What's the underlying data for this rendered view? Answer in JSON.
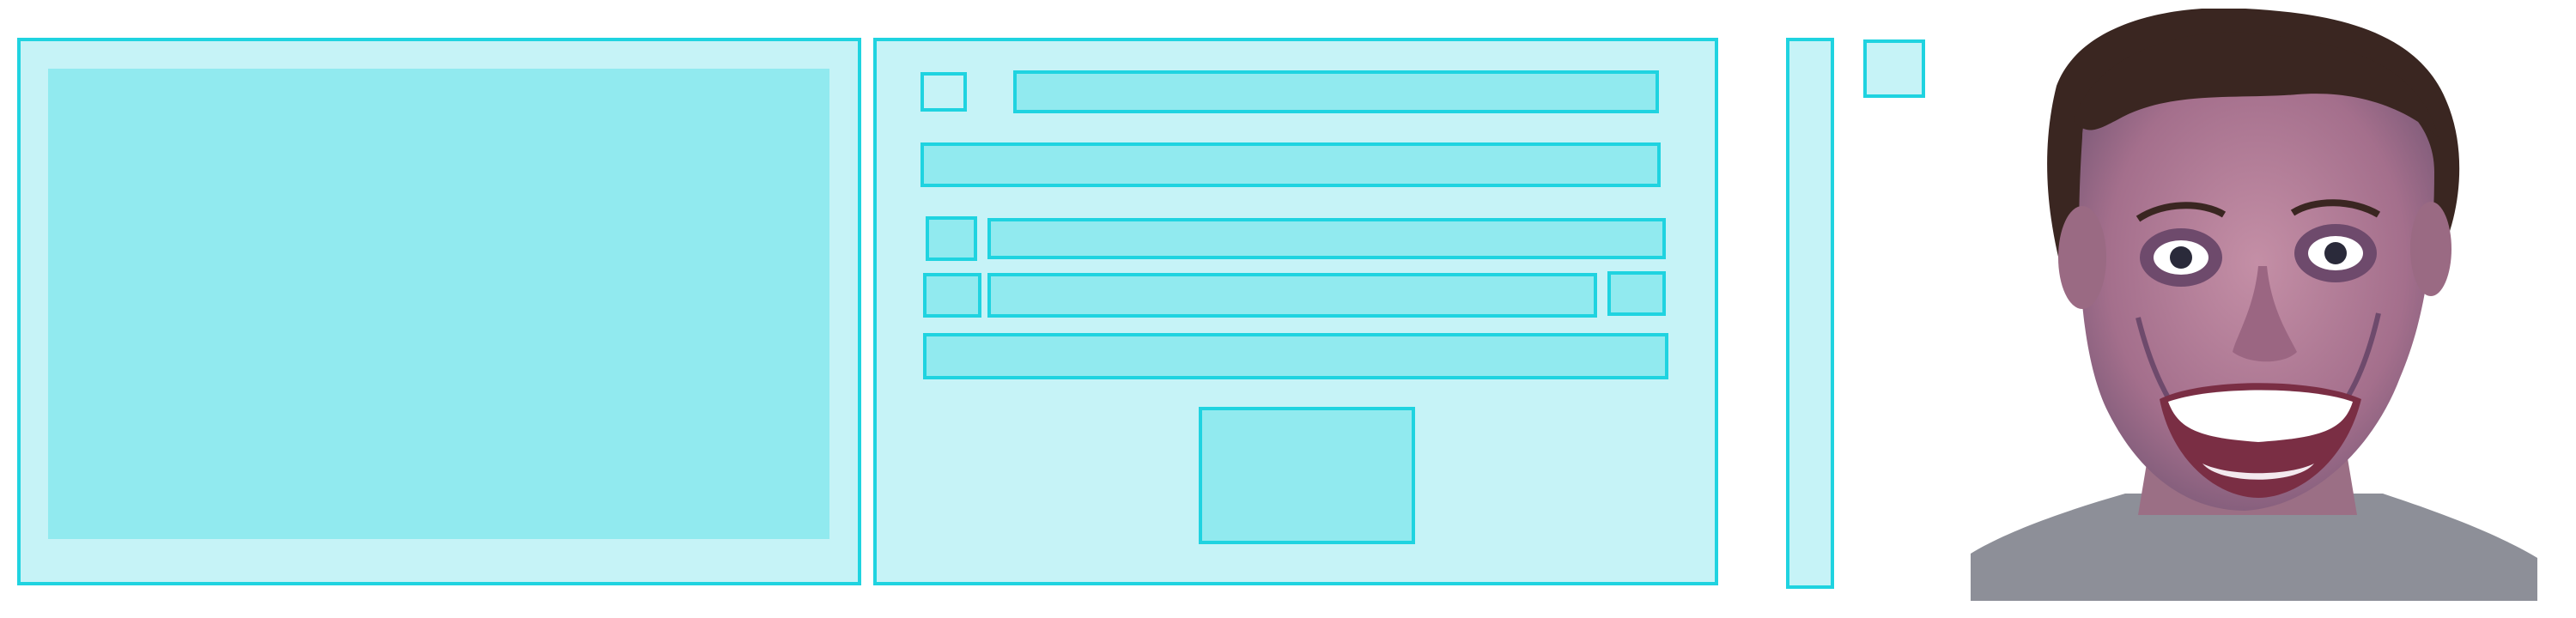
{
  "wireframe": {
    "palette": {
      "border": "#1fd3e0",
      "panel_fill": "#c6f3f7",
      "block_fill": "#91eaef",
      "background": "#ffffff"
    }
  },
  "photo": {
    "icon": "face-photo",
    "palette": {
      "hair": "#3a2621",
      "skin": "#b07c93",
      "skin_shadow": "#7c5a78",
      "teeth": "#ffffff",
      "shirt": "#8d8f98"
    }
  }
}
